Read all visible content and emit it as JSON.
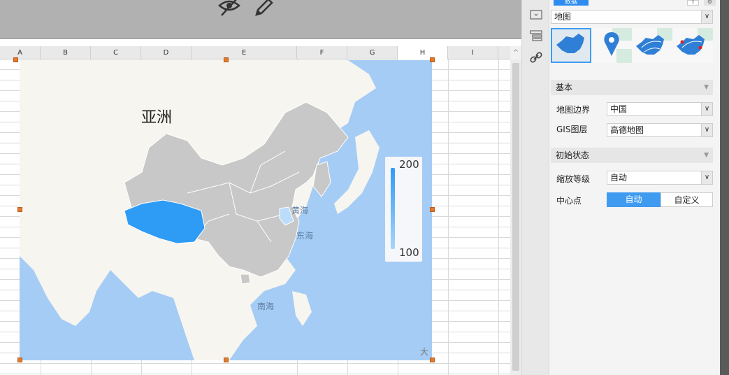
{
  "toolbar": {
    "icons": [
      "hide-eye-icon",
      "edit-pencil-icon"
    ]
  },
  "sheet": {
    "columns": [
      "A",
      "B",
      "C",
      "D",
      "E",
      "F",
      "G",
      "H",
      "I"
    ],
    "active_column": "H",
    "scroll_up_glyph": "^"
  },
  "map": {
    "title": "亚洲",
    "labels": {
      "yellow_sea": "黄海",
      "east_sea": "东海",
      "south_sea": "南海",
      "corner": "大"
    },
    "legend": {
      "max": "200",
      "min": "100"
    },
    "colors": {
      "ocean": "#a5ccf5",
      "land": "#f7f5ef",
      "china": "#c8c8c8",
      "highlight_max": "#2e9bf5",
      "highlight_min": "#bcdcfb"
    }
  },
  "side_icons": [
    "widget-icon",
    "layers-list-icon",
    "link-icon"
  ],
  "panel": {
    "tab_label": "数据",
    "top_buttons": [
      "!",
      "⚙"
    ],
    "map_type_select": {
      "value": "地图"
    },
    "thumbnails": [
      "region-map",
      "point-map",
      "flow-map",
      "heat-map"
    ],
    "selected_thumbnail": 0,
    "sections": {
      "basic": {
        "title": "基本"
      },
      "initial_state": {
        "title": "初始状态"
      }
    },
    "fields": {
      "map_boundary": {
        "label": "地图边界",
        "value": "中国"
      },
      "gis_layer": {
        "label": "GIS图层",
        "value": "高德地图"
      },
      "zoom_level": {
        "label": "缩放等级",
        "value": "自动"
      },
      "center_point": {
        "label": "中心点",
        "options": [
          "自动",
          "自定义"
        ],
        "selected": "自动"
      }
    },
    "caret_glyph": "▼",
    "select_arrow_glyph": "∨"
  }
}
